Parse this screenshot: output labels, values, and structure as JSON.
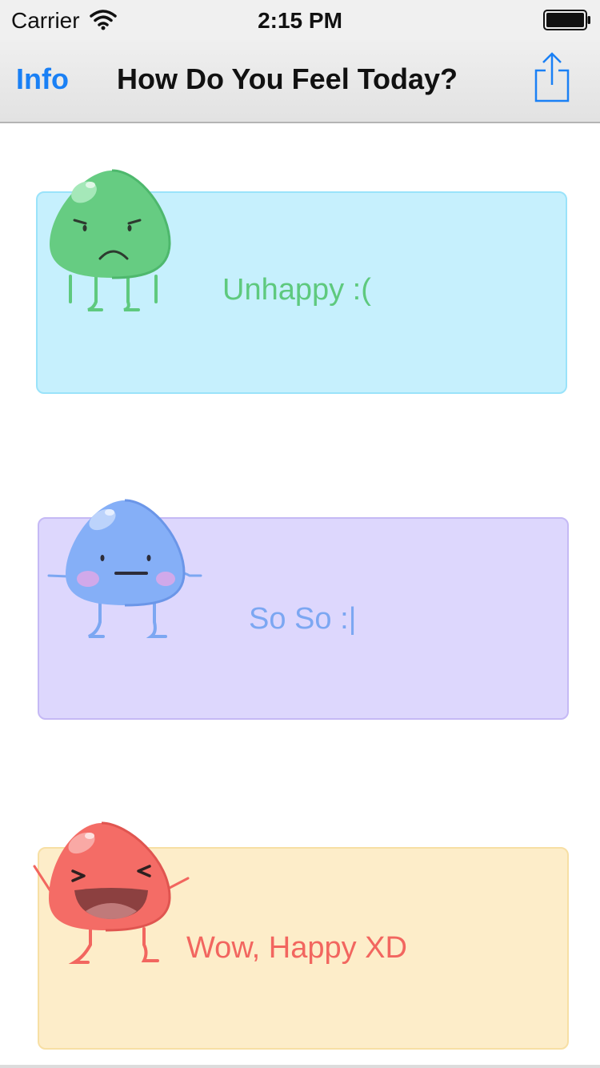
{
  "status_bar": {
    "carrier": "Carrier",
    "time": "2:15 PM",
    "icons": [
      "wifi-icon",
      "battery-icon"
    ]
  },
  "nav": {
    "info_label": "Info",
    "title": "How Do You Feel Today?",
    "share_icon": "share-icon",
    "accent_color": "#1a80f5"
  },
  "moods": [
    {
      "label": "Unhappy :(",
      "color": "#5ec97e",
      "card_color": "#c6f0fd",
      "icon": "sad-monster-icon"
    },
    {
      "label": "So So :|",
      "color": "#7ca7f2",
      "card_color": "#ddd7fd",
      "icon": "neutral-monster-icon"
    },
    {
      "label": "Wow, Happy XD",
      "color": "#f2665f",
      "card_color": "#fdedc9",
      "icon": "happy-monster-icon"
    }
  ]
}
